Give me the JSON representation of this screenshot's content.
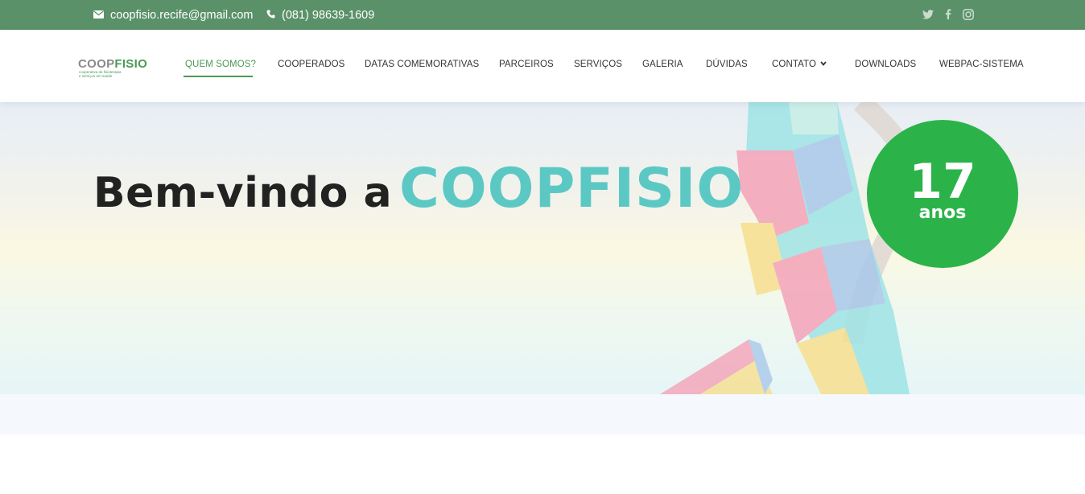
{
  "topbar": {
    "email": "coopfisio.recife@gmail.com",
    "phone": "(081) 98639-1609",
    "social": [
      "twitter-icon",
      "facebook-icon",
      "instagram-icon"
    ]
  },
  "logo": {
    "part1": "COOP",
    "part2": "FISIO",
    "tagline1": "cooperativa de fisioterapia",
    "tagline2": "e serviços em saúde"
  },
  "nav": {
    "items": [
      {
        "label": "QUEM SOMOS?",
        "active": true
      },
      {
        "label": "COOPERADOS"
      },
      {
        "label": "DATAS COMEMORATIVAS"
      },
      {
        "label": "PARCEIROS"
      },
      {
        "label": "SERVIÇOS"
      },
      {
        "label": "GALERIA"
      },
      {
        "label": "DÚVIDAS"
      },
      {
        "label": "CONTATO",
        "dropdown": true
      },
      {
        "label": "DOWNLOADS"
      },
      {
        "label": "WEBPAC-SISTEMA"
      }
    ]
  },
  "hero": {
    "title_prefix": "Bem-vindo a",
    "title_brand": "COOPFISIO",
    "badge_number": "17",
    "badge_unit": "anos"
  },
  "colors": {
    "topbar": "#5a9168",
    "accent_green": "#4a9a55",
    "brand_teal": "#5cc8c4",
    "badge_green": "#2bb34a"
  }
}
